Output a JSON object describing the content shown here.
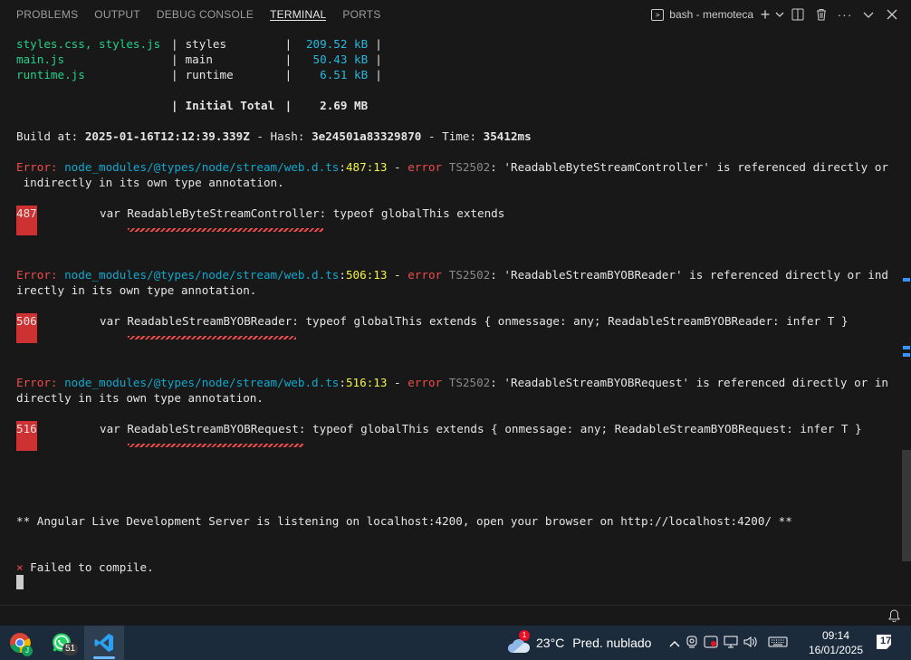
{
  "panel": {
    "tabs": [
      {
        "label": "PROBLEMS",
        "active": false
      },
      {
        "label": "OUTPUT",
        "active": false
      },
      {
        "label": "DEBUG CONSOLE",
        "active": false
      },
      {
        "label": "TERMINAL",
        "active": true
      },
      {
        "label": "PORTS",
        "active": false
      }
    ],
    "terminal_name": "bash - memoteca",
    "icons": [
      "terminal-icon",
      "add-terminal-icon",
      "chevron-down-icon",
      "split-terminal-icon",
      "trash-icon",
      "more-icon",
      "maximize-chevron-icon",
      "close-icon"
    ]
  },
  "terminal": {
    "bundle_table": [
      {
        "files": "styles.css, styles.js",
        "names": "styles",
        "size": "209.52 kB"
      },
      {
        "files": "main.js",
        "names": "main",
        "size": "50.43 kB"
      },
      {
        "files": "runtime.js",
        "names": "runtime",
        "size": "6.51 kB"
      }
    ],
    "sep": "|",
    "initial_total_label": "Initial Total",
    "initial_total_value": "2.69 MB",
    "build": {
      "prefix": "Build at: ",
      "date": "2025-01-16T12:12:39.339Z",
      "hash_label": " - Hash: ",
      "hash": "3e24501a83329870",
      "time_label": " - Time: ",
      "time": "35412ms"
    },
    "errors": [
      {
        "label": "Error: ",
        "path": "node_modules/@types/node/stream/web.d.ts",
        "colon": ":",
        "loc": "487:13",
        "dash": " - ",
        "error_word": "error",
        "code": "TS2502",
        "msg_line1": ": 'ReadableByteStreamController' is referenced directly or",
        "msg_line2": " indirectly in its own type annotation.",
        "line_no": "487",
        "code_line": "var ReadableByteStreamController: typeof globalThis extends"
      },
      {
        "label": "Error: ",
        "path": "node_modules/@types/node/stream/web.d.ts",
        "colon": ":",
        "loc": "506:13",
        "dash": " - ",
        "error_word": "error",
        "code": "TS2502",
        "msg_line1": ": 'ReadableStreamBYOBReader' is referenced directly or ind",
        "msg_line2": "irectly in its own type annotation.",
        "line_no": "506",
        "code_line": "var ReadableStreamBYOBReader: typeof globalThis extends { onmessage: any; ReadableStreamBYOBReader: infer T }"
      },
      {
        "label": "Error: ",
        "path": "node_modules/@types/node/stream/web.d.ts",
        "colon": ":",
        "loc": "516:13",
        "dash": " - ",
        "error_word": "error",
        "code": "TS2502",
        "msg_line1": ": 'ReadableStreamBYOBRequest' is referenced directly or in",
        "msg_line2": "directly in its own type annotation.",
        "line_no": "516",
        "code_line": "var ReadableStreamBYOBRequest: typeof globalThis extends { onmessage: any; ReadableStreamBYOBRequest: infer T }"
      }
    ],
    "server_msg": "** Angular Live Development Server is listening on localhost:4200, open your browser on http://localhost:4200/ **",
    "fail_mark": "×",
    "fail_msg": " Failed to compile."
  },
  "taskbar": {
    "apps": [
      {
        "name": "chrome",
        "badge": ""
      },
      {
        "name": "whatsapp",
        "badge": "51"
      },
      {
        "name": "vscode",
        "badge": ""
      }
    ],
    "weather_badge": "1",
    "temperature": "23°C",
    "weather_text": "Pred. nublado",
    "time": "09:14",
    "date": "16/01/2025",
    "notification_count": "17"
  },
  "colors": {
    "success": "#23d18b",
    "info": "#29b8db",
    "error": "#f14c4c",
    "warning": "#f5f543"
  }
}
